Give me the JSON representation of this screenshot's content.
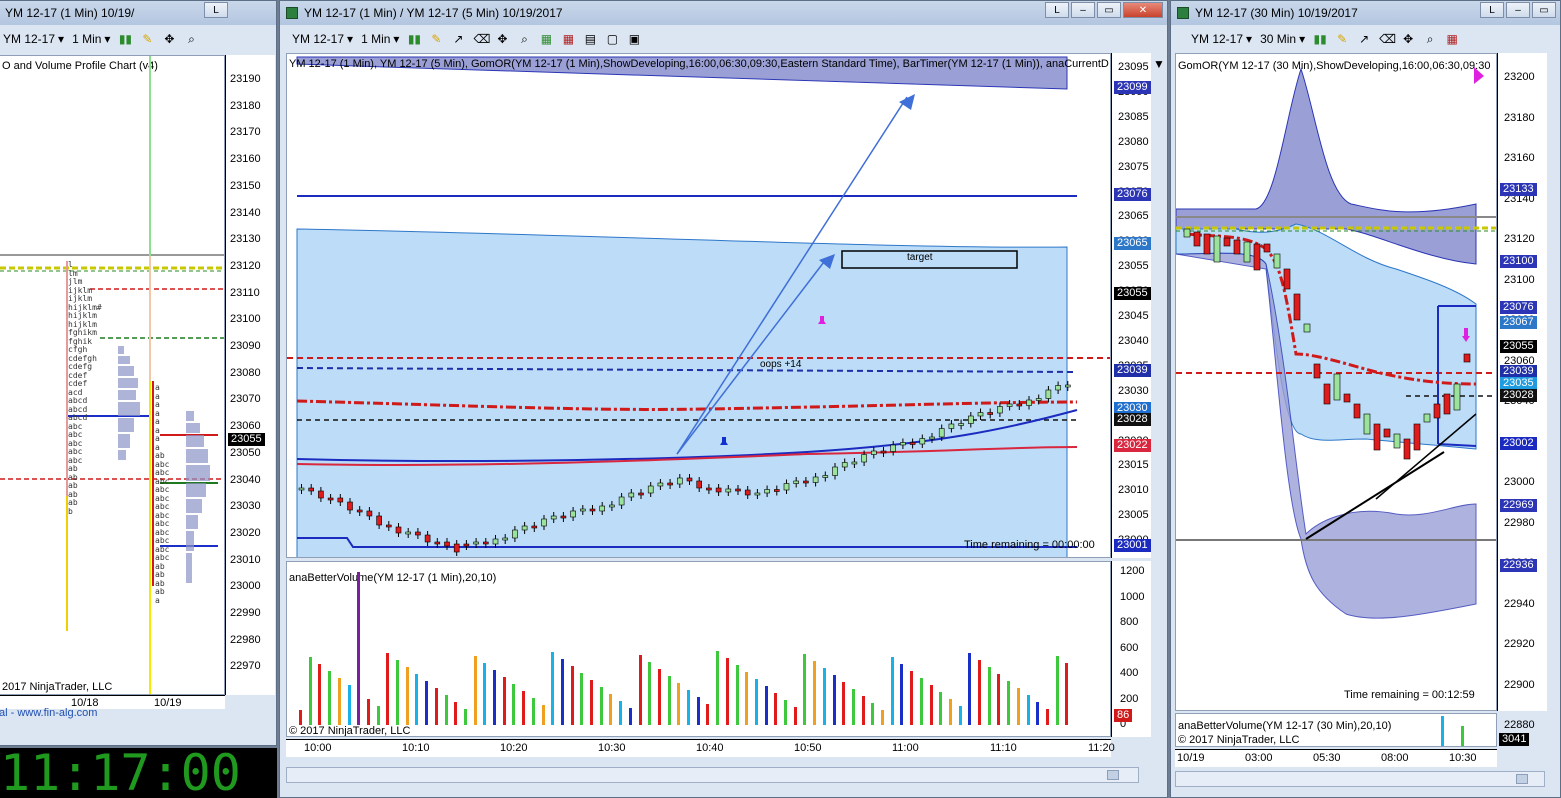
{
  "left_window": {
    "title": "YM 12-17 (1 Min)  10/19/",
    "toolbar": {
      "instrument": "YM 12-17",
      "interval": "1 Min"
    },
    "indicator_label": "O and Volume Profile Chart (v4)",
    "copyright": "2017 NinjaTrader, LLC",
    "link": "al - www.fin-alg.com",
    "price_ticks": [
      "23190",
      "23180",
      "23170",
      "23160",
      "23150",
      "23140",
      "23130",
      "23120",
      "23110",
      "23100",
      "23090",
      "23080",
      "23070",
      "23060",
      "23050",
      "23040",
      "23030",
      "23020",
      "23010",
      "23000",
      "22990",
      "22980",
      "22970"
    ],
    "last_price": "23055",
    "date_labels": [
      "10/18",
      "10/19"
    ]
  },
  "clock": "11:17:00",
  "center_window": {
    "title": "YM 12-17 (1 Min) / YM 12-17 (5 Min)  10/19/2017",
    "toolbar": {
      "instrument": "YM 12-17",
      "interval": "1 Min"
    },
    "indicator_label": "YM 12-17 (1 Min), YM 12-17 (5 Min), GomOR(YM 12-17 (1 Min),ShowDeveloping,16:00,06:30,09:30,Eastern Standard Time), BarTimer(YM 12-17 (1 Min)), anaCurrentD",
    "annotations": {
      "target": "target",
      "oops": "oops +14"
    },
    "time_remaining": "Time remaining = 00:00:00",
    "price_ticks": [
      "23095",
      "23090",
      "23085",
      "23080",
      "23075",
      "23070",
      "23065",
      "23060",
      "23055",
      "23050",
      "23045",
      "23040",
      "23035",
      "23030",
      "23025",
      "23020",
      "23015",
      "23010",
      "23005",
      "23000"
    ],
    "price_tags": [
      {
        "label": "23099",
        "color": "#2b35b5"
      },
      {
        "label": "23076",
        "color": "#2b35b5"
      },
      {
        "label": "23065",
        "color": "#2d77c9"
      },
      {
        "label": "23055",
        "color": "#000000"
      },
      {
        "label": "23039",
        "color": "#1f2fa8"
      },
      {
        "label": "23030",
        "color": "#1f6fd0"
      },
      {
        "label": "23028",
        "color": "#111111"
      },
      {
        "label": "23022",
        "color": "#d8273f"
      },
      {
        "label": "23001",
        "color": "#1b2bc0"
      }
    ],
    "volume_label": "anaBetterVolume(YM 12-17 (1 Min),20,10)",
    "volume_ticks": [
      "1200",
      "1000",
      "800",
      "600",
      "400",
      "200",
      "0"
    ],
    "volume_tag": "86",
    "copyright": "© 2017 NinjaTrader, LLC",
    "time_ticks": [
      "10:00",
      "10:10",
      "10:20",
      "10:30",
      "10:40",
      "10:50",
      "11:00",
      "11:10",
      "11:20"
    ]
  },
  "right_window": {
    "title": "YM 12-17 (30 Min)  10/19/2017",
    "toolbar": {
      "instrument": "YM 12-17",
      "interval": "30 Min"
    },
    "indicator_label": "GomOR(YM 12-17 (30 Min),ShowDeveloping,16:00,06:30,09:30",
    "price_ticks": [
      "23200",
      "23180",
      "23160",
      "23140",
      "23120",
      "23100",
      "23080",
      "23060",
      "23040",
      "23020",
      "23000",
      "22980",
      "22960",
      "22940",
      "22920",
      "22900",
      "22880"
    ],
    "price_tags": [
      {
        "label": "23133",
        "color": "#2b35b5"
      },
      {
        "label": "23100",
        "color": "#2b35b5"
      },
      {
        "label": "23076",
        "color": "#2b35b5"
      },
      {
        "label": "23067",
        "color": "#2d77c9"
      },
      {
        "label": "23055",
        "color": "#000000"
      },
      {
        "label": "23039",
        "color": "#1f2fa8"
      },
      {
        "label": "23035",
        "color": "#1f9ce0"
      },
      {
        "label": "23028",
        "color": "#111111"
      },
      {
        "label": "23002",
        "color": "#1b2bc0"
      },
      {
        "label": "22969",
        "color": "#2b35b5"
      },
      {
        "label": "22936",
        "color": "#2b35b5"
      }
    ],
    "time_remaining": "Time remaining = 00:12:59",
    "volume_label": "anaBetterVolume(YM 12-17 (30 Min),20,10)",
    "copyright": "© 2017 NinjaTrader, LLC",
    "volume_tag": "3041",
    "time_ticks": [
      "10/19",
      "03:00",
      "05:30",
      "08:00",
      "10:30"
    ]
  }
}
